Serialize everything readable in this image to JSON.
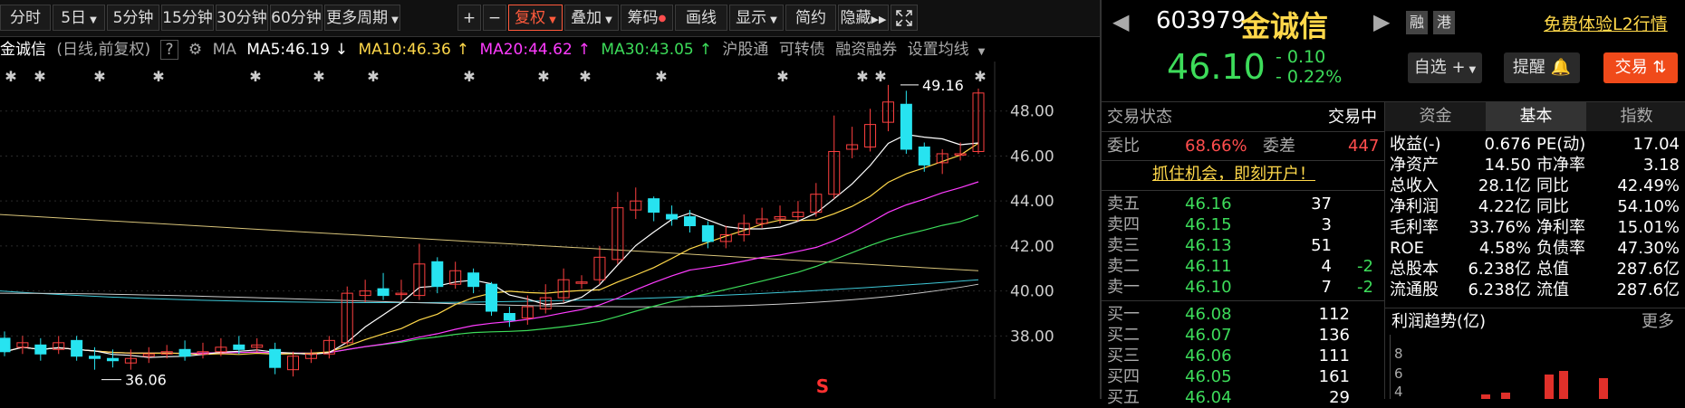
{
  "toolbar": {
    "buttons": [
      "分时",
      "5日",
      "5分钟",
      "15分钟",
      "30分钟",
      "60分钟",
      "更多周期"
    ],
    "tools": [
      "+",
      "−",
      "复权",
      "叠加",
      "筹码",
      "画线",
      "显示",
      "简约",
      "隐藏"
    ]
  },
  "maline": {
    "name": "金诚信",
    "mode": "(日线,前复权)",
    "help": "?",
    "ma": "MA",
    "ma5": "MA5:46.19",
    "ma10": "MA10:46.36",
    "ma20": "MA20:44.62",
    "ma30": "MA30:43.05",
    "links": [
      "沪股通",
      "可转债",
      "融资融券",
      "设置均线"
    ]
  },
  "chart_data": {
    "type": "candlestick",
    "y_ticks": [
      "48.00",
      "46.00",
      "44.00",
      "42.00",
      "40.00",
      "38.00"
    ],
    "ylim": [
      35.2,
      50.2
    ],
    "high_label": "49.16",
    "low_label": "36.06",
    "marker": "S",
    "candles": [
      [
        37.9,
        37.3,
        38.2,
        37.1
      ],
      [
        37.5,
        37.7,
        38.0,
        37.2
      ],
      [
        37.6,
        37.2,
        37.9,
        36.9
      ],
      [
        37.4,
        37.7,
        38.0,
        37.2
      ],
      [
        37.8,
        37.1,
        38.0,
        36.9
      ],
      [
        37.1,
        37.0,
        37.5,
        36.5
      ],
      [
        37.0,
        36.9,
        37.4,
        36.6
      ],
      [
        36.8,
        37.0,
        37.4,
        36.5
      ],
      [
        37.1,
        37.2,
        37.5,
        36.8
      ],
      [
        37.2,
        37.3,
        37.6,
        37.0
      ],
      [
        37.4,
        37.1,
        37.8,
        36.9
      ],
      [
        37.2,
        37.3,
        37.7,
        37.0
      ],
      [
        37.3,
        37.5,
        37.9,
        37.1
      ],
      [
        37.6,
        37.4,
        38.0,
        37.2
      ],
      [
        37.5,
        37.6,
        37.9,
        37.3
      ],
      [
        37.4,
        36.6,
        37.7,
        36.3
      ],
      [
        36.5,
        37.1,
        37.3,
        36.2
      ],
      [
        37.0,
        37.2,
        37.4,
        36.8
      ],
      [
        37.2,
        37.8,
        38.0,
        37.0
      ],
      [
        37.7,
        39.9,
        40.2,
        37.6
      ],
      [
        39.8,
        40.0,
        40.5,
        39.5
      ],
      [
        40.1,
        39.8,
        40.8,
        39.6
      ],
      [
        39.9,
        39.9,
        40.5,
        39.6
      ],
      [
        39.8,
        41.2,
        42.1,
        39.6
      ],
      [
        41.3,
        40.2,
        41.5,
        39.9
      ],
      [
        40.3,
        40.9,
        41.3,
        40.1
      ],
      [
        40.8,
        40.2,
        41.0,
        39.9
      ],
      [
        40.3,
        39.1,
        40.4,
        38.9
      ],
      [
        39.0,
        38.7,
        39.3,
        38.4
      ],
      [
        38.8,
        39.3,
        39.8,
        38.5
      ],
      [
        39.2,
        39.7,
        40.3,
        39.0
      ],
      [
        39.7,
        40.5,
        41.0,
        39.5
      ],
      [
        40.4,
        40.4,
        40.7,
        40.1
      ],
      [
        40.5,
        41.5,
        42.0,
        40.3
      ],
      [
        41.4,
        43.7,
        44.4,
        41.2
      ],
      [
        43.6,
        44.0,
        44.6,
        43.2
      ],
      [
        44.1,
        43.5,
        44.2,
        43.1
      ],
      [
        43.4,
        43.2,
        43.8,
        42.9
      ],
      [
        43.3,
        42.9,
        43.6,
        42.6
      ],
      [
        42.9,
        42.2,
        43.1,
        41.9
      ],
      [
        42.2,
        42.5,
        42.9,
        41.9
      ],
      [
        42.5,
        43.0,
        43.4,
        42.2
      ],
      [
        43.0,
        43.2,
        43.7,
        42.8
      ],
      [
        43.2,
        43.3,
        43.8,
        43.0
      ],
      [
        43.3,
        43.5,
        44.0,
        43.1
      ],
      [
        43.5,
        44.3,
        44.8,
        43.3
      ],
      [
        44.3,
        46.2,
        47.8,
        44.1
      ],
      [
        46.3,
        46.5,
        47.3,
        45.9
      ],
      [
        46.4,
        47.4,
        48.1,
        46.2
      ],
      [
        47.5,
        48.4,
        49.16,
        47.1
      ],
      [
        48.3,
        46.3,
        48.9,
        46.1
      ],
      [
        46.4,
        45.6,
        46.6,
        45.3
      ],
      [
        45.7,
        46.1,
        46.3,
        45.2
      ],
      [
        46.1,
        46.1,
        46.6,
        45.8
      ],
      [
        46.2,
        48.8,
        49.0,
        46.1
      ]
    ]
  },
  "quote": {
    "code": "603979",
    "name": "金诚信",
    "tag1": "融",
    "tag2": "港",
    "promo": "免费体验L2行情",
    "price": "46.10",
    "change": "- 0.10",
    "change_pct": "- 0.22%",
    "btn_watch": "自选 +",
    "btn_remind": "提醒",
    "btn_trade": "交易",
    "status_label": "交易状态",
    "status_value": "交易中",
    "weibi_label": "委比",
    "weibi_value": "68.66%",
    "weicha_label": "委差",
    "weicha_value": "447",
    "slogan": "抓住机会，即刻开户！"
  },
  "tabs": [
    "资金",
    "基本",
    "指数"
  ],
  "asks": [
    {
      "label": "卖五",
      "price": "46.16",
      "vol": "37",
      "chg": ""
    },
    {
      "label": "卖四",
      "price": "46.15",
      "vol": "3",
      "chg": ""
    },
    {
      "label": "卖三",
      "price": "46.13",
      "vol": "51",
      "chg": ""
    },
    {
      "label": "卖二",
      "price": "46.11",
      "vol": "4",
      "chg": "-2"
    },
    {
      "label": "卖一",
      "price": "46.10",
      "vol": "7",
      "chg": "-2"
    }
  ],
  "bids": [
    {
      "label": "买一",
      "price": "46.08",
      "vol": "112"
    },
    {
      "label": "买二",
      "price": "46.07",
      "vol": "136"
    },
    {
      "label": "买三",
      "price": "46.06",
      "vol": "111"
    },
    {
      "label": "买四",
      "price": "46.05",
      "vol": "161"
    },
    {
      "label": "买五",
      "price": "46.04",
      "vol": "29"
    }
  ],
  "fundamentals": [
    {
      "k1": "收益(-)",
      "v1": "0.676",
      "k2": "PE(动)",
      "v2": "17.04"
    },
    {
      "k1": "净资产",
      "v1": "14.50",
      "k2": "市净率",
      "v2": "3.18"
    },
    {
      "k1": "总收入",
      "v1": "28.1亿",
      "k2": "同比",
      "v2": "42.49%"
    },
    {
      "k1": "净利润",
      "v1": "4.22亿",
      "k2": "同比",
      "v2": "54.10%"
    },
    {
      "k1": "毛利率",
      "v1": "33.76%",
      "k2": "净利率",
      "v2": "15.01%"
    },
    {
      "k1": "ROE",
      "v1": "4.58%",
      "k2": "负债率",
      "v2": "47.30%"
    },
    {
      "k1": "总股本",
      "v1": "6.238亿",
      "k2": "总值",
      "v2": "287.6亿"
    },
    {
      "k1": "流通股",
      "v1": "6.238亿",
      "k2": "流值",
      "v2": "287.6亿"
    }
  ],
  "profit": {
    "title": "利润趋势(亿)",
    "more": "更多",
    "ticks": [
      "8",
      "6",
      "4"
    ]
  }
}
